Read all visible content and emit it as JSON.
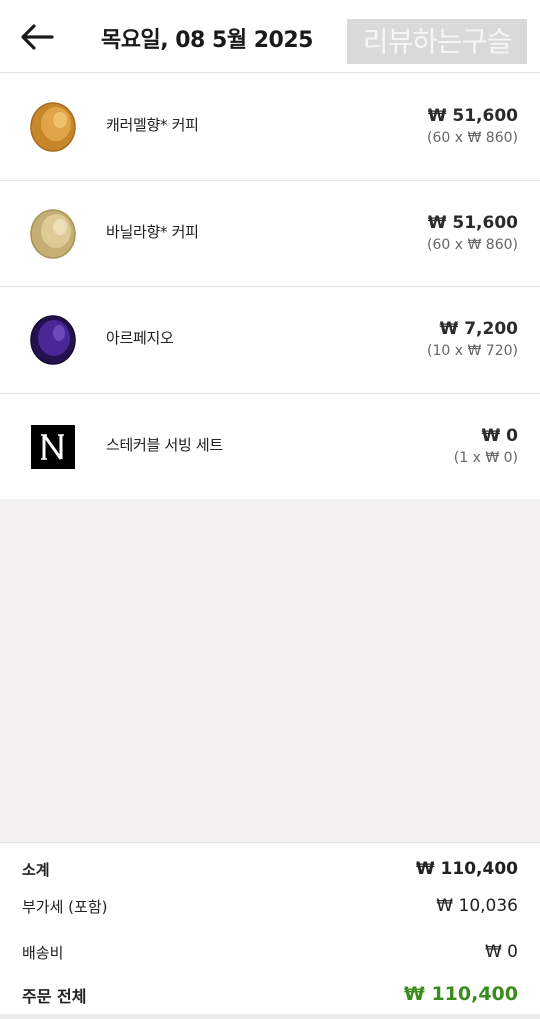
{
  "header": {
    "title": "목요일, 08 5월 2025",
    "watermark": "리뷰하는구슬"
  },
  "items": [
    {
      "name": "캐러멜향* 커피",
      "price": "₩ 51,600",
      "detail": "(60 x ₩ 860)",
      "icon": "caramel-capsule-icon",
      "color": "#d4952f"
    },
    {
      "name": "바닐라향* 커피",
      "price": "₩ 51,600",
      "detail": "(60 x ₩ 860)",
      "icon": "vanilla-capsule-icon",
      "color": "#d8c48e"
    },
    {
      "name": "아르페지오",
      "price": "₩ 7,200",
      "detail": "(10 x ₩ 720)",
      "icon": "arpeggio-capsule-icon",
      "color": "#3d1f7a"
    },
    {
      "name": "스테커블 서빙 세트",
      "price": "₩ 0",
      "detail": "(1 x ₩ 0)",
      "icon": "nespresso-logo-icon",
      "color": "#000000"
    }
  ],
  "summary": {
    "subtotal_label": "소계",
    "subtotal_value": "₩ 110,400",
    "vat_label": "부가세 (포함)",
    "vat_value": "₩ 10,036",
    "shipping_label": "배송비",
    "shipping_value": "₩ 0",
    "total_label": "주문 전체",
    "total_value": "₩ 110,400"
  },
  "colors": {
    "total_green": "#3a8a1e",
    "background_gray": "#f2f1ef"
  }
}
